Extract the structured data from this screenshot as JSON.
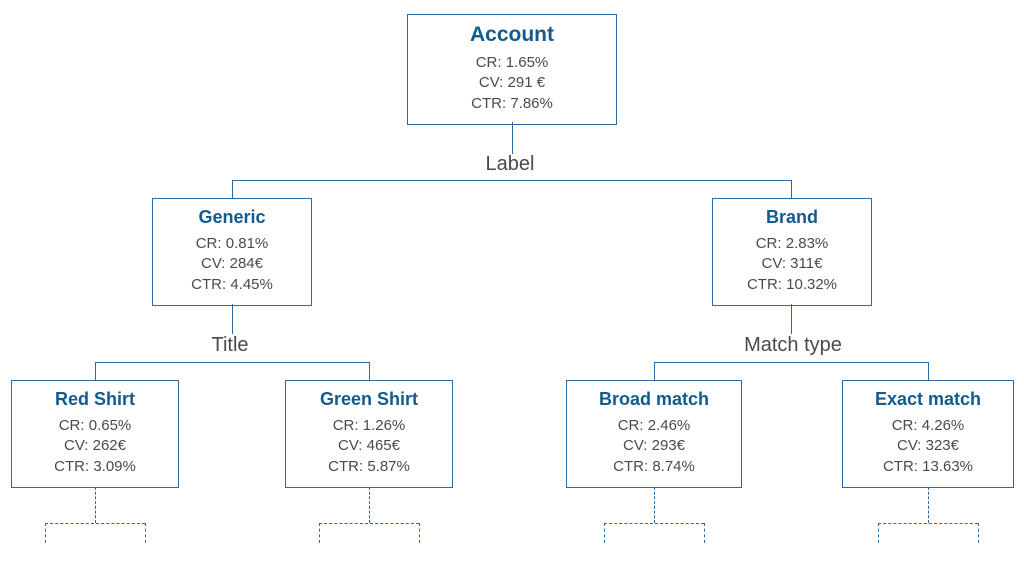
{
  "metric_prefixes": {
    "cr": "CR:",
    "cv": "CV:",
    "ctr": "CTR:"
  },
  "root": {
    "title": "Account",
    "cr": "1.65%",
    "cv": "291 €",
    "ctr": "7.86%"
  },
  "split_labels": {
    "level1": "Label",
    "generic_children": "Title",
    "brand_children": "Match type"
  },
  "level1": {
    "generic": {
      "title": "Generic",
      "cr": "0.81%",
      "cv": "284€",
      "ctr": "4.45%"
    },
    "brand": {
      "title": "Brand",
      "cr": "2.83%",
      "cv": "311€",
      "ctr": "10.32%"
    }
  },
  "level2": {
    "red_shirt": {
      "title": "Red Shirt",
      "cr": "0.65%",
      "cv": "262€",
      "ctr": "3.09%"
    },
    "green_shirt": {
      "title": "Green Shirt",
      "cr": "1.26%",
      "cv": "465€",
      "ctr": "5.87%"
    },
    "broad_match": {
      "title": "Broad match",
      "cr": "2.46%",
      "cv": "293€",
      "ctr": "8.74%"
    },
    "exact_match": {
      "title": "Exact match",
      "cr": "4.26%",
      "cv": "323€",
      "ctr": "13.63%"
    }
  }
}
